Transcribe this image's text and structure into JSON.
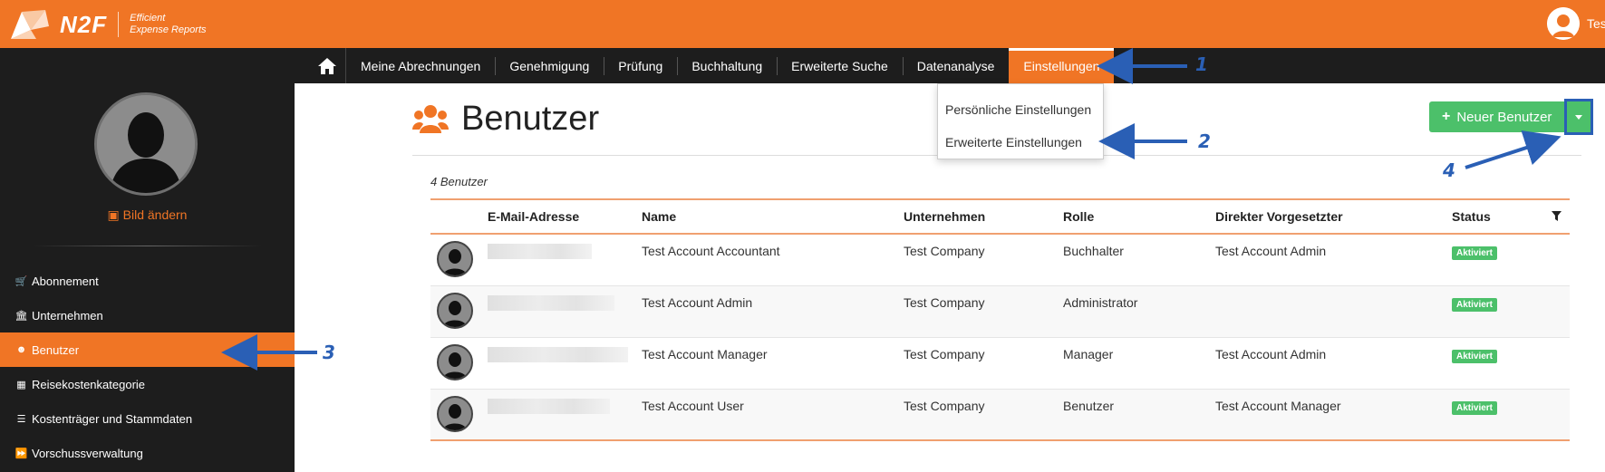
{
  "app": {
    "logo_text": "N2F",
    "tagline_1": "Efficient",
    "tagline_2": "Expense Reports",
    "user_name": "Test"
  },
  "nav": {
    "items": [
      {
        "label": "Meine Abrechnungen"
      },
      {
        "label": "Genehmigung"
      },
      {
        "label": "Prüfung"
      },
      {
        "label": "Buchhaltung"
      },
      {
        "label": "Erweiterte Suche"
      },
      {
        "label": "Datenanalyse"
      },
      {
        "label": "Einstellungen",
        "active": true
      }
    ],
    "dropdown": [
      "Persönliche Einstellungen",
      "Erweiterte Einstellungen"
    ]
  },
  "sidebar": {
    "change_picture": "Bild ändern",
    "items": [
      {
        "label": "Abonnement",
        "icon": "cart-icon"
      },
      {
        "label": "Unternehmen",
        "icon": "bank-icon"
      },
      {
        "label": "Benutzer",
        "icon": "users-icon",
        "active": true
      },
      {
        "label": "Reisekostenkategorie",
        "icon": "grid-icon"
      },
      {
        "label": "Kostenträger und Stammdaten",
        "icon": "list-icon"
      },
      {
        "label": "Vorschussverwaltung",
        "icon": "forward-icon"
      }
    ]
  },
  "page": {
    "title": "Benutzer",
    "new_user_button": "Neuer Benutzer",
    "count_text": "4 Benutzer"
  },
  "table": {
    "columns": [
      "E-Mail-Adresse",
      "Name",
      "Unternehmen",
      "Rolle",
      "Direkter Vorgesetzter",
      "Status"
    ],
    "rows": [
      {
        "name": "Test Account Accountant",
        "company": "Test Company",
        "role": "Buchhalter",
        "manager": "Test Account Admin",
        "status": "Aktiviert"
      },
      {
        "name": "Test Account Admin",
        "company": "Test Company",
        "role": "Administrator",
        "manager": "",
        "status": "Aktiviert"
      },
      {
        "name": "Test Account Manager",
        "company": "Test Company",
        "role": "Manager",
        "manager": "Test Account Admin",
        "status": "Aktiviert"
      },
      {
        "name": "Test Account User",
        "company": "Test Company",
        "role": "Benutzer",
        "manager": "Test Account Manager",
        "status": "Aktiviert"
      }
    ]
  },
  "annotations": {
    "labels": [
      "1",
      "2",
      "3",
      "4"
    ],
    "color": "#2a5fb5"
  },
  "colors": {
    "brand_orange": "#f07525",
    "nav_dark": "#1d1d1d",
    "success_green": "#4cc06a"
  }
}
